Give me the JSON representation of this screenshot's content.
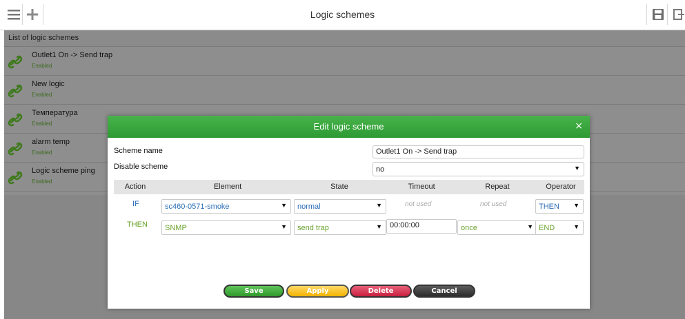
{
  "toolbar": {
    "title": "Logic schemes",
    "menu_icon": "menu-icon",
    "add_icon": "plus-icon",
    "save_icon": "floppy-disk-icon",
    "exit_icon": "exit-icon"
  },
  "list": {
    "header": "List of logic schemes",
    "items": [
      {
        "name": "Outlet1 On -> Send trap",
        "status": "Enabled"
      },
      {
        "name": "New logic",
        "status": "Enabled"
      },
      {
        "name": "Температура",
        "status": "Enabled"
      },
      {
        "name": "alarm temp",
        "status": "Enabled"
      },
      {
        "name": "Logic scheme ping",
        "status": "Enabled"
      }
    ]
  },
  "modal": {
    "title": "Edit logic scheme",
    "close": "×",
    "scheme_name_label": "Scheme name",
    "scheme_name_value": "Outlet1 On -> Send trap",
    "disable_label": "Disable scheme",
    "disable_value": "no",
    "columns": {
      "action": "Action",
      "element": "Element",
      "state": "State",
      "timeout": "Timeout",
      "repeat": "Repeat",
      "operator": "Operator"
    },
    "row_if": {
      "action": "IF",
      "element": "sc460-0571-smoke",
      "state": "normal",
      "timeout": "not used",
      "repeat": "not used",
      "operator": "THEN"
    },
    "row_then": {
      "action": "THEN",
      "element": "SNMP",
      "state": "send trap",
      "timeout": "00:00:00",
      "repeat": "once",
      "operator": "END"
    },
    "buttons": {
      "save": "Save",
      "apply": "Apply",
      "delete": "Delete",
      "cancel": "Cancel"
    }
  },
  "colors": {
    "header_green": "#3aa63f",
    "if_blue": "#2d6fb7",
    "then_green": "#6aa32d",
    "enabled_green": "#3d6b1f"
  }
}
